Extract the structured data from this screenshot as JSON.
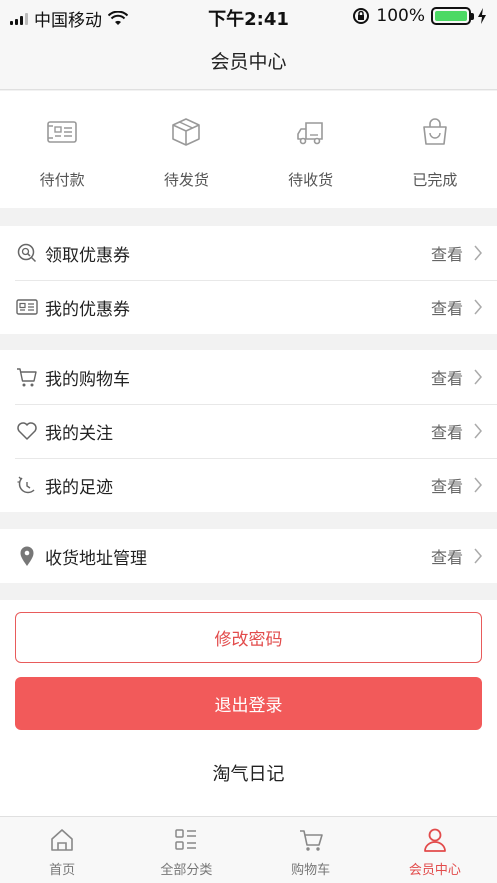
{
  "status_bar": {
    "carrier": "中国移动",
    "time": "下午2:41",
    "battery": "100%"
  },
  "nav": {
    "title": "会员中心"
  },
  "orders": [
    {
      "label": "待付款",
      "icon": "wallet-card-icon"
    },
    {
      "label": "待发货",
      "icon": "box-icon"
    },
    {
      "label": "待收货",
      "icon": "truck-icon"
    },
    {
      "label": "已完成",
      "icon": "bag-icon"
    }
  ],
  "menu": {
    "coupons_group": [
      {
        "label": "领取优惠券",
        "action": "查看",
        "icon": "coupon-search-icon"
      },
      {
        "label": "我的优惠券",
        "action": "查看",
        "icon": "coupon-card-icon"
      }
    ],
    "shopping_group": [
      {
        "label": "我的购物车",
        "action": "查看",
        "icon": "cart-icon"
      },
      {
        "label": "我的关注",
        "action": "查看",
        "icon": "heart-icon"
      },
      {
        "label": "我的足迹",
        "action": "查看",
        "icon": "footprint-icon"
      }
    ],
    "address_group": [
      {
        "label": "收货地址管理",
        "action": "查看",
        "icon": "location-pin-icon"
      }
    ]
  },
  "buttons": {
    "change_password": "修改密码",
    "logout": "退出登录"
  },
  "footer_text": "淘气日记",
  "tabs": [
    {
      "label": "首页",
      "icon": "home-icon",
      "active": false
    },
    {
      "label": "全部分类",
      "icon": "category-icon",
      "active": false
    },
    {
      "label": "购物车",
      "icon": "cart-icon",
      "active": false
    },
    {
      "label": "会员中心",
      "icon": "user-icon",
      "active": true
    }
  ],
  "colors": {
    "accent": "#f25a5a",
    "accent_text": "#e24b4b",
    "battery": "#4cd964"
  }
}
